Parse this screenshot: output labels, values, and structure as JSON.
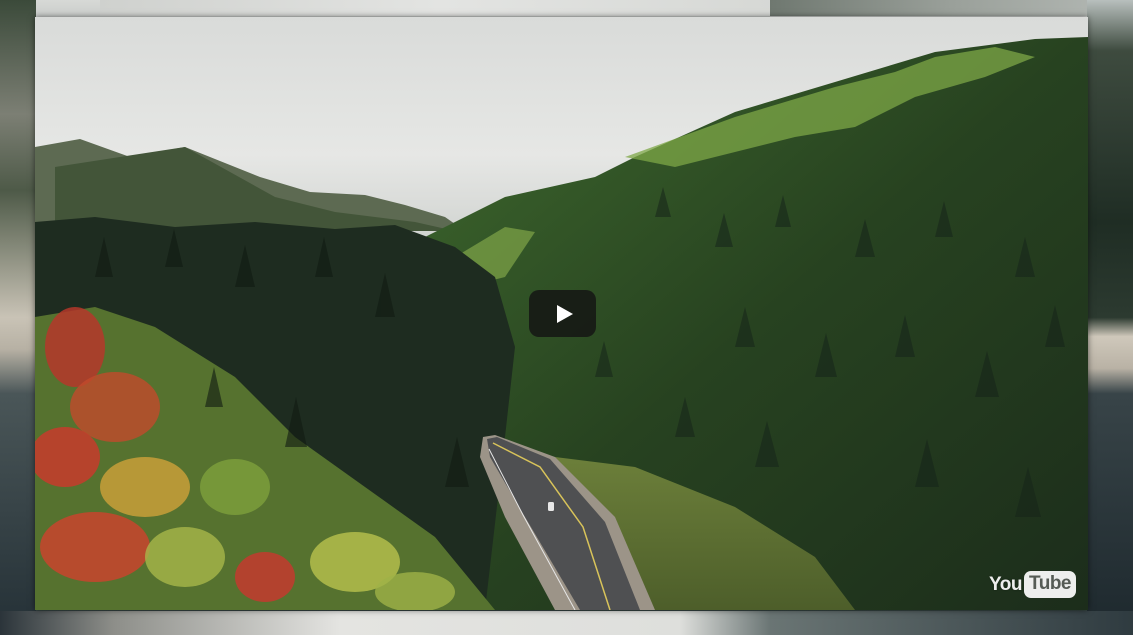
{
  "player": {
    "play_button_icon": "play-icon",
    "logo": {
      "part_one": "You",
      "part_two": "Tube",
      "icon": "youtube-logo"
    }
  },
  "colors": {
    "sky": "#dcdedc",
    "forest_dark": "#1f2c22",
    "forest_light": "#6f9a3a",
    "autumn_red": "#c0392b",
    "road": "#5a5a5c",
    "play_button_bg": "#141414"
  }
}
